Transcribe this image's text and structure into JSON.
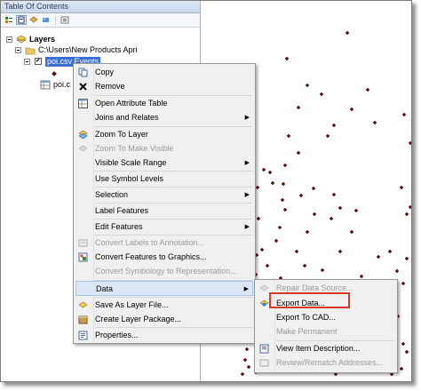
{
  "toc": {
    "title": "Table Of Contents",
    "layers_label": "Layers",
    "path_label": "C:\\Users\\New Products Apri",
    "selected_layer": "poi.csv Events",
    "table_label": "poi.c"
  },
  "context_menu": {
    "items": [
      {
        "label": "Copy",
        "disabled": false,
        "submenu": false,
        "icon": "copy-icon"
      },
      {
        "label": "Remove",
        "disabled": false,
        "submenu": false,
        "icon": "remove-icon"
      },
      {
        "label": "Open Attribute Table",
        "disabled": false,
        "submenu": false,
        "icon": "table-icon"
      },
      {
        "label": "Joins and Relates",
        "disabled": false,
        "submenu": true,
        "icon": ""
      },
      {
        "label": "Zoom To Layer",
        "disabled": false,
        "submenu": false,
        "icon": "zoom-layer-icon"
      },
      {
        "label": "Zoom To Make Visible",
        "disabled": true,
        "submenu": false,
        "icon": "zoom-visible-icon"
      },
      {
        "label": "Visible Scale Range",
        "disabled": false,
        "submenu": true,
        "icon": ""
      },
      {
        "label": "Use Symbol Levels",
        "disabled": false,
        "submenu": false,
        "icon": ""
      },
      {
        "label": "Selection",
        "disabled": false,
        "submenu": true,
        "icon": ""
      },
      {
        "label": "Label Features",
        "disabled": false,
        "submenu": false,
        "icon": ""
      },
      {
        "label": "Edit Features",
        "disabled": false,
        "submenu": true,
        "icon": ""
      },
      {
        "label": "Convert Labels to Annotation...",
        "disabled": true,
        "submenu": false,
        "icon": "convert-labels-icon"
      },
      {
        "label": "Convert Features to Graphics...",
        "disabled": false,
        "submenu": false,
        "icon": "convert-features-icon"
      },
      {
        "label": "Convert Symbology to Representation...",
        "disabled": true,
        "submenu": false,
        "icon": ""
      },
      {
        "label": "Data",
        "disabled": false,
        "submenu": true,
        "icon": ""
      },
      {
        "label": "Save As Layer File...",
        "disabled": false,
        "submenu": false,
        "icon": "save-layer-icon"
      },
      {
        "label": "Create Layer Package...",
        "disabled": false,
        "submenu": false,
        "icon": "layer-package-icon"
      },
      {
        "label": "Properties...",
        "disabled": false,
        "submenu": false,
        "icon": "properties-icon"
      }
    ]
  },
  "data_submenu": {
    "items": [
      {
        "label": "Repair Data Source...",
        "disabled": true,
        "icon": "repair-icon"
      },
      {
        "label": "Export Data...",
        "disabled": false,
        "icon": "export-icon"
      },
      {
        "label": "Export To CAD...",
        "disabled": false,
        "icon": ""
      },
      {
        "label": "Make Permanent",
        "disabled": true,
        "icon": ""
      },
      {
        "label": "View Item Description...",
        "disabled": false,
        "icon": "description-icon"
      },
      {
        "label": "Review/Rematch Addresses...",
        "disabled": true,
        "icon": "rematch-icon"
      }
    ]
  },
  "colors": {
    "point": "#5a0d0d",
    "selection": "#3a6fd1",
    "highlight_box": "#d63a2a"
  }
}
